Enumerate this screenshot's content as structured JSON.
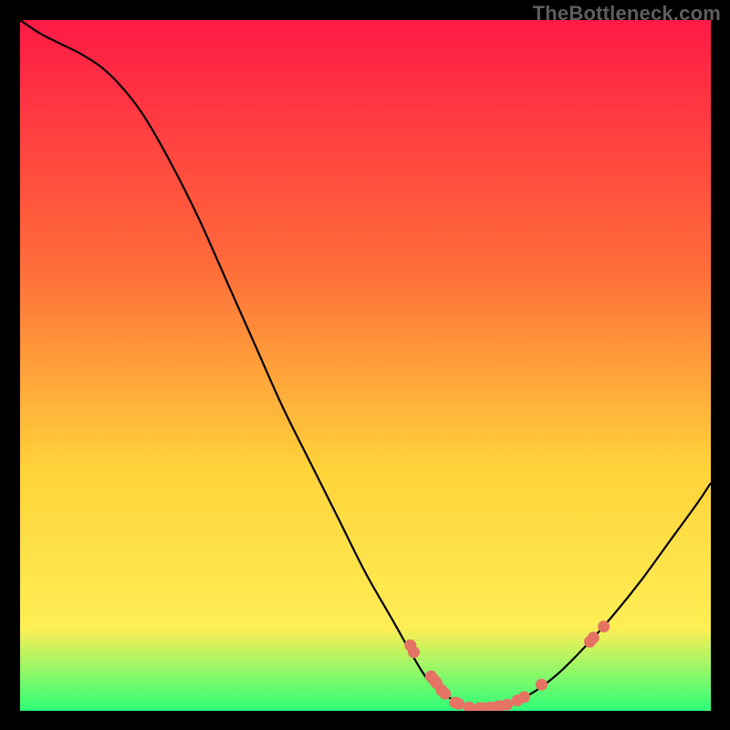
{
  "watermark": "TheBottleneck.com",
  "colors": {
    "black": "#000000",
    "curve": "#000000",
    "dot": "#e57363",
    "grad_top": "#ff1a46",
    "grad_mid1": "#ff6a3a",
    "grad_mid2": "#ffd33a",
    "grad_mid3": "#ffee55",
    "grad_bot": "#2cff78"
  },
  "chart_data": {
    "type": "line",
    "title": "",
    "xlabel": "",
    "ylabel": "",
    "xlim": [
      0,
      100
    ],
    "ylim": [
      0,
      100
    ],
    "curve": {
      "x": [
        0,
        3,
        6,
        9,
        12,
        15,
        18,
        22,
        26,
        30,
        34,
        38,
        42,
        46,
        50,
        54,
        58,
        60,
        62,
        64,
        66,
        70,
        74,
        78,
        82,
        86,
        90,
        94,
        98,
        100
      ],
      "y": [
        100,
        98,
        96.5,
        95,
        93,
        90,
        86,
        79,
        71,
        62,
        53,
        44,
        36,
        28,
        20,
        13,
        6,
        3.5,
        2,
        1,
        0.5,
        0.8,
        2.5,
        5.5,
        9.5,
        14,
        19,
        24.5,
        30,
        33
      ]
    },
    "dots": [
      {
        "x": 56.5,
        "y": 9.5
      },
      {
        "x": 57.0,
        "y": 8.5
      },
      {
        "x": 59.5,
        "y": 5.0
      },
      {
        "x": 60.0,
        "y": 4.4
      },
      {
        "x": 60.3,
        "y": 4.0
      },
      {
        "x": 61.0,
        "y": 3.0
      },
      {
        "x": 61.5,
        "y": 2.5
      },
      {
        "x": 63.0,
        "y": 1.2
      },
      {
        "x": 63.5,
        "y": 1.0
      },
      {
        "x": 65.0,
        "y": 0.5
      },
      {
        "x": 66.5,
        "y": 0.4
      },
      {
        "x": 67.0,
        "y": 0.4
      },
      {
        "x": 68.0,
        "y": 0.5
      },
      {
        "x": 69.0,
        "y": 0.6
      },
      {
        "x": 69.5,
        "y": 0.7
      },
      {
        "x": 70.5,
        "y": 0.9
      },
      {
        "x": 72.0,
        "y": 1.5
      },
      {
        "x": 73.0,
        "y": 2.0
      },
      {
        "x": 75.5,
        "y": 3.8
      },
      {
        "x": 82.5,
        "y": 10.0
      },
      {
        "x": 83.0,
        "y": 10.6
      },
      {
        "x": 84.5,
        "y": 12.2
      }
    ]
  }
}
